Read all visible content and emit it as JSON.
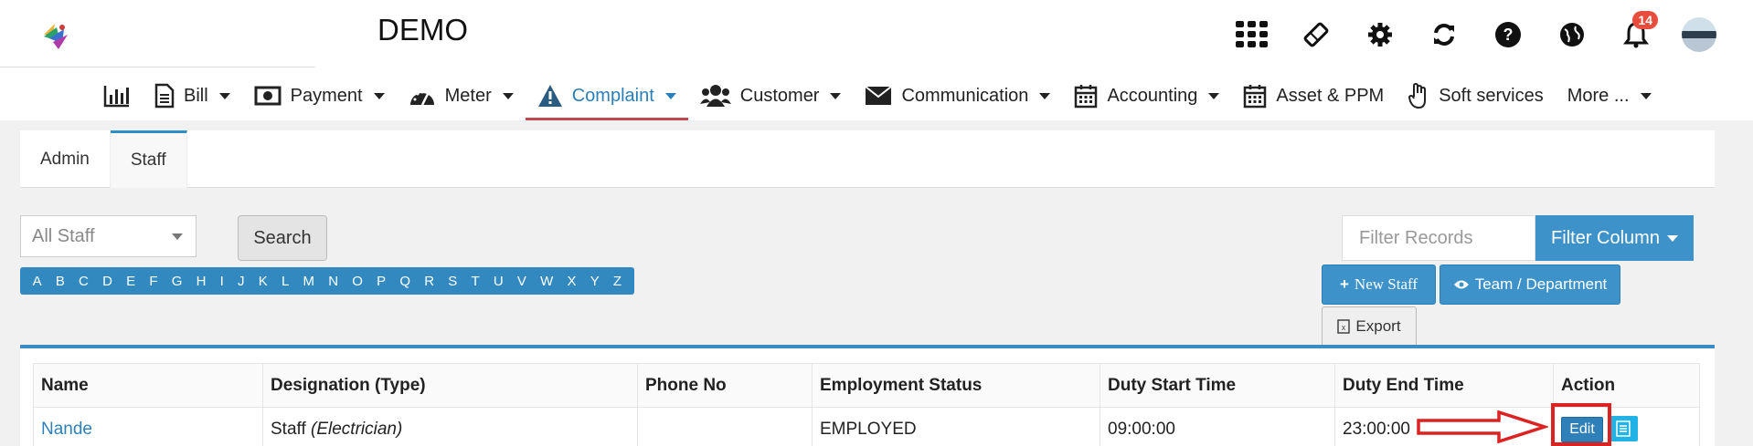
{
  "app": {
    "title": "DEMO"
  },
  "top_icons": [
    {
      "name": "apps-grid-icon"
    },
    {
      "name": "ticket-icon"
    },
    {
      "name": "gear-icon"
    },
    {
      "name": "refresh-icon"
    },
    {
      "name": "help-icon"
    },
    {
      "name": "globe-icon"
    },
    {
      "name": "bell-icon",
      "badge": "14"
    }
  ],
  "nav": {
    "items": [
      {
        "label": "",
        "icon": "bar-chart-icon"
      },
      {
        "label": "Bill",
        "icon": "document-icon",
        "dropdown": true
      },
      {
        "label": "Payment",
        "icon": "money-icon",
        "dropdown": true
      },
      {
        "label": "Meter",
        "icon": "gauge-icon",
        "dropdown": true
      },
      {
        "label": "Complaint",
        "icon": "warning-icon",
        "dropdown": true,
        "active": true
      },
      {
        "label": "Customer",
        "icon": "users-icon",
        "dropdown": true
      },
      {
        "label": "Communication",
        "icon": "envelope-icon",
        "dropdown": true
      },
      {
        "label": "Accounting",
        "icon": "calendar-icon",
        "dropdown": true
      },
      {
        "label": "Asset & PPM",
        "icon": "calendar-icon"
      },
      {
        "label": "Soft services",
        "icon": "hand-icon"
      },
      {
        "label": "More ...",
        "dropdown": true
      }
    ]
  },
  "tabs": [
    {
      "label": "Admin"
    },
    {
      "label": "Staff",
      "active": true
    }
  ],
  "filters": {
    "staff_select": "All Staff",
    "search_label": "Search",
    "alphabet": [
      "A",
      "B",
      "C",
      "D",
      "E",
      "F",
      "G",
      "H",
      "I",
      "J",
      "K",
      "L",
      "M",
      "N",
      "O",
      "P",
      "Q",
      "R",
      "S",
      "T",
      "U",
      "V",
      "W",
      "X",
      "Y",
      "Z"
    ],
    "filter_placeholder": "Filter Records",
    "filter_column_label": "Filter Column"
  },
  "actions": {
    "new_staff": "New Staff",
    "team_department": "Team / Department",
    "export": "Export"
  },
  "table": {
    "headers": [
      "Name",
      "Designation (Type)",
      "Phone No",
      "Employment Status",
      "Duty Start Time",
      "Duty End Time",
      "Action"
    ],
    "rows": [
      {
        "name": "Nande",
        "designation": "Staff",
        "type": "(Electrician)",
        "phone": "",
        "status": "EMPLOYED",
        "start": "09:00:00",
        "end": "23:00:00",
        "edit": "Edit"
      }
    ]
  },
  "colors": {
    "accent": "#3d93c9",
    "active_nav": "#2a7fb8",
    "active_underline": "#c0494f",
    "annotation": "#dd2222",
    "badge": "#e74c3c"
  }
}
